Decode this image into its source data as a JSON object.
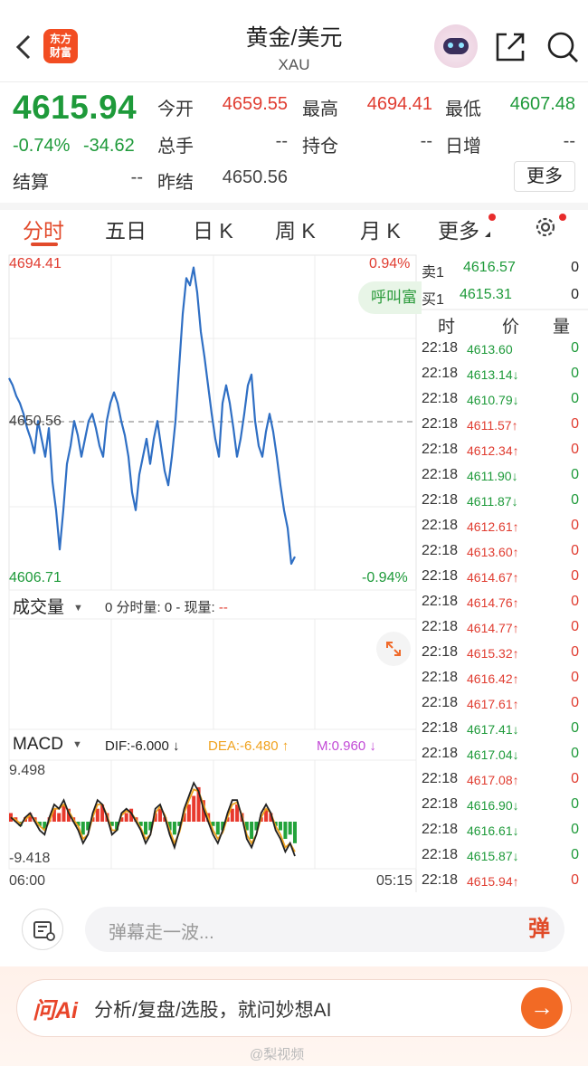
{
  "header": {
    "logo_text": "东方\n财富",
    "title": "黄金/美元",
    "subtitle": "XAU"
  },
  "quote": {
    "price": "4615.94",
    "change_pct": "-0.74%",
    "change_abs": "-34.62",
    "open_label": "今开",
    "open": "4659.55",
    "high_label": "最高",
    "high": "4694.41",
    "low_label": "最低",
    "low": "4607.48",
    "volume_label": "总手",
    "volume": "--",
    "position_label": "持仓",
    "position": "--",
    "daily_inc_label": "日增",
    "daily_inc": "--",
    "settle_label": "结算",
    "settle": "--",
    "prev_settle_label": "昨结",
    "prev_settle": "4650.56",
    "more_label": "更多"
  },
  "tabs": [
    "分时",
    "五日",
    "日 K",
    "周 K",
    "月 K",
    "更多"
  ],
  "chart": {
    "high_label": "4694.41",
    "mid_label": "4650.56",
    "low_label": "4606.71",
    "pct_up": "0.94%",
    "pct_down": "-0.94%",
    "call_button": "呼叫富",
    "time_start": "06:00",
    "time_end": "05:15"
  },
  "chart_data": {
    "type": "line",
    "ylim": [
      4606.71,
      4694.41
    ],
    "reference": 4650.56,
    "y": [
      4662,
      4660,
      4657,
      4655,
      4652,
      4648,
      4645,
      4641,
      4650,
      4645,
      4640,
      4648,
      4633,
      4625,
      4614,
      4625,
      4638,
      4643,
      4650,
      4646,
      4640,
      4645,
      4650,
      4652,
      4648,
      4643,
      4640,
      4650,
      4655,
      4658,
      4655,
      4650,
      4646,
      4640,
      4630,
      4625,
      4635,
      4640,
      4645,
      4638,
      4645,
      4650,
      4643,
      4636,
      4632,
      4640,
      4650,
      4665,
      4680,
      4690,
      4688,
      4693,
      4686,
      4675,
      4668,
      4660,
      4652,
      4645,
      4640,
      4655,
      4660,
      4655,
      4648,
      4640,
      4645,
      4652,
      4660,
      4663,
      4650,
      4643,
      4640,
      4647,
      4652,
      4647,
      4640,
      4632,
      4625,
      4620,
      4610,
      4612
    ]
  },
  "book": {
    "ask_label": "卖1",
    "ask_price": "4616.57",
    "ask_qty": "0",
    "bid_label": "买1",
    "bid_price": "4615.31",
    "bid_qty": "0"
  },
  "trades_header": {
    "time": "时",
    "price": "价",
    "qty": "量"
  },
  "trades": [
    {
      "time": "22:18",
      "price": "4613.60",
      "arrow": "",
      "qty": "0",
      "dir": "green"
    },
    {
      "time": "22:18",
      "price": "4613.14",
      "arrow": "↓",
      "qty": "0",
      "dir": "green"
    },
    {
      "time": "22:18",
      "price": "4610.79",
      "arrow": "↓",
      "qty": "0",
      "dir": "green"
    },
    {
      "time": "22:18",
      "price": "4611.57",
      "arrow": "↑",
      "qty": "0",
      "dir": "red"
    },
    {
      "time": "22:18",
      "price": "4612.34",
      "arrow": "↑",
      "qty": "0",
      "dir": "red"
    },
    {
      "time": "22:18",
      "price": "4611.90",
      "arrow": "↓",
      "qty": "0",
      "dir": "green"
    },
    {
      "time": "22:18",
      "price": "4611.87",
      "arrow": "↓",
      "qty": "0",
      "dir": "green"
    },
    {
      "time": "22:18",
      "price": "4612.61",
      "arrow": "↑",
      "qty": "0",
      "dir": "red"
    },
    {
      "time": "22:18",
      "price": "4613.60",
      "arrow": "↑",
      "qty": "0",
      "dir": "red"
    },
    {
      "time": "22:18",
      "price": "4614.67",
      "arrow": "↑",
      "qty": "0",
      "dir": "red"
    },
    {
      "time": "22:18",
      "price": "4614.76",
      "arrow": "↑",
      "qty": "0",
      "dir": "red"
    },
    {
      "time": "22:18",
      "price": "4614.77",
      "arrow": "↑",
      "qty": "0",
      "dir": "red"
    },
    {
      "time": "22:18",
      "price": "4615.32",
      "arrow": "↑",
      "qty": "0",
      "dir": "red"
    },
    {
      "time": "22:18",
      "price": "4616.42",
      "arrow": "↑",
      "qty": "0",
      "dir": "red"
    },
    {
      "time": "22:18",
      "price": "4617.61",
      "arrow": "↑",
      "qty": "0",
      "dir": "red"
    },
    {
      "time": "22:18",
      "price": "4617.41",
      "arrow": "↓",
      "qty": "0",
      "dir": "green"
    },
    {
      "time": "22:18",
      "price": "4617.04",
      "arrow": "↓",
      "qty": "0",
      "dir": "green"
    },
    {
      "time": "22:18",
      "price": "4617.08",
      "arrow": "↑",
      "qty": "0",
      "dir": "red"
    },
    {
      "time": "22:18",
      "price": "4616.90",
      "arrow": "↓",
      "qty": "0",
      "dir": "green"
    },
    {
      "time": "22:18",
      "price": "4616.61",
      "arrow": "↓",
      "qty": "0",
      "dir": "green"
    },
    {
      "time": "22:18",
      "price": "4615.87",
      "arrow": "↓",
      "qty": "0",
      "dir": "green"
    },
    {
      "time": "22:18",
      "price": "4615.94",
      "arrow": "↑",
      "qty": "0",
      "dir": "red"
    }
  ],
  "volume": {
    "selector": "成交量",
    "info_prefix": "0 分时量: 0 - 现量:",
    "info_value": "--"
  },
  "macd": {
    "selector": "MACD",
    "dif": "DIF:-6.000 ↓",
    "dea": "DEA:-6.480 ↑",
    "m": "M:0.960 ↓",
    "max_label": "9.498",
    "min_label": "-9.418",
    "ylim": [
      -9.418,
      9.498
    ],
    "bars": [
      2,
      1,
      -1,
      1,
      2,
      1,
      -1,
      -2,
      1,
      3,
      2,
      4,
      3,
      1,
      -1,
      -3,
      -2,
      1,
      3,
      4,
      2,
      -1,
      -2,
      1,
      2,
      3,
      1,
      -1,
      -3,
      -2,
      2,
      3,
      1,
      -2,
      -3,
      -1,
      2,
      4,
      6,
      8,
      5,
      2,
      -1,
      -3,
      -2,
      1,
      3,
      4,
      2,
      -2,
      -4,
      -2,
      1,
      3,
      2,
      -1,
      -2,
      -4,
      -3,
      -5
    ],
    "dif_line": [
      1,
      0,
      -1,
      1,
      2,
      0,
      -2,
      -3,
      1,
      4,
      3,
      5,
      2,
      0,
      -2,
      -5,
      -3,
      2,
      5,
      4,
      1,
      -3,
      -2,
      2,
      3,
      2,
      0,
      -2,
      -5,
      -3,
      3,
      4,
      1,
      -3,
      -6,
      -2,
      3,
      6,
      9,
      7,
      3,
      0,
      -3,
      -5,
      -2,
      2,
      5,
      5,
      1,
      -4,
      -6,
      -3,
      2,
      4,
      2,
      -2,
      -4,
      -7,
      -5,
      -8
    ],
    "dea_line": [
      1,
      0.5,
      -0.5,
      0.5,
      1.5,
      0.5,
      -1,
      -2,
      0,
      3,
      3,
      4,
      2.5,
      0.5,
      -1,
      -4,
      -3,
      1,
      4,
      4,
      1.5,
      -2,
      -2,
      1.5,
      2.5,
      2,
      0.5,
      -1.5,
      -4,
      -3,
      2,
      3.5,
      1.5,
      -2,
      -5,
      -2.5,
      2,
      5,
      7.5,
      7,
      4,
      1,
      -2,
      -4,
      -2.5,
      1,
      4,
      4.5,
      1.5,
      -3,
      -5,
      -3,
      1,
      3,
      2,
      -1,
      -3,
      -6,
      -5,
      -7
    ]
  },
  "bottom": {
    "danmu_placeholder": "弹幕走一波...",
    "danmu_button": "弹",
    "ai_logo": "问Ai",
    "ai_prompt": "分析/复盘/选股，就问妙想AI",
    "ai_go": "→",
    "watermark": "@梨视频"
  }
}
